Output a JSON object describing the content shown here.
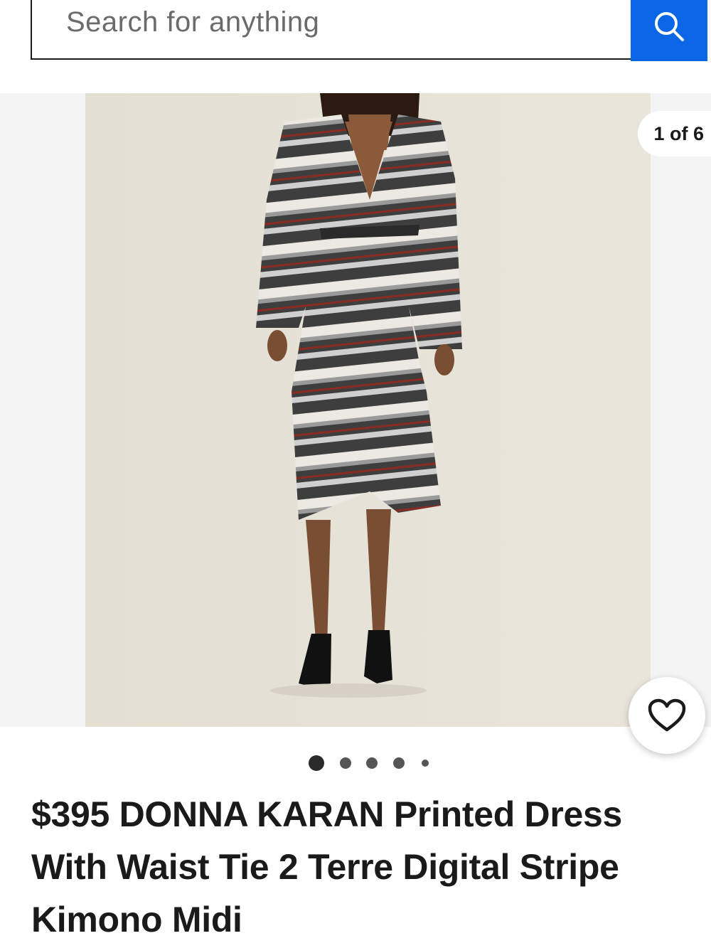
{
  "search": {
    "placeholder": "Search for anything",
    "icon": "search-icon",
    "button_color": "#0a66e4"
  },
  "gallery": {
    "counter": "1 of 6",
    "current_index": 1,
    "total_images": 6,
    "image_description_icon": "product-photo",
    "favorite_icon": "heart-icon",
    "dots_visible": 5,
    "active_dot": 0
  },
  "product": {
    "title": "$395 DONNA KARAN Printed Dress With Waist Tie 2 Terre Digital Stripe Kimono Midi"
  }
}
